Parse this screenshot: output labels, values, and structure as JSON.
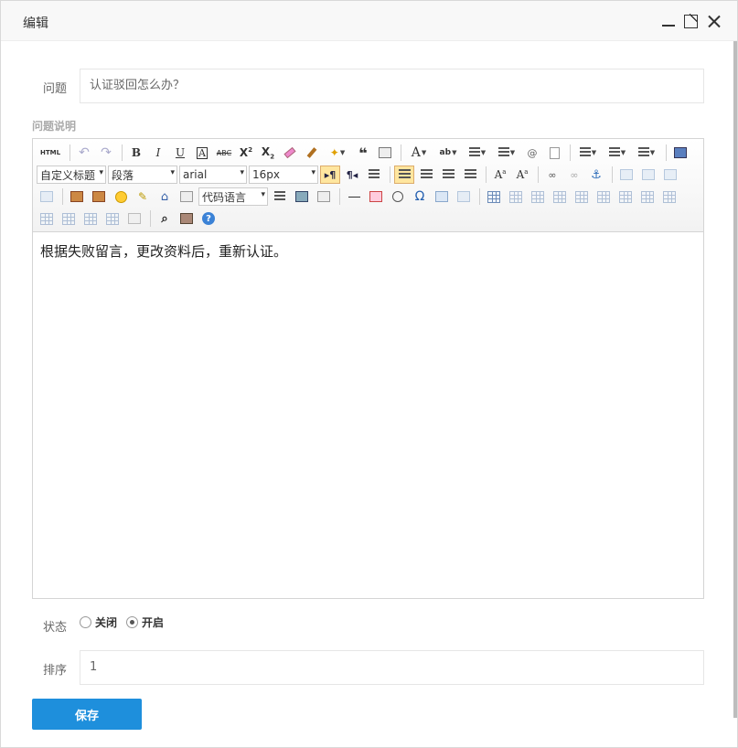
{
  "window": {
    "title": "编辑"
  },
  "form": {
    "question_label": "问题",
    "question_value": "认证驳回怎么办？",
    "description_label": "问题说明",
    "status_label": "状态",
    "status_options": [
      "关闭",
      "开启"
    ],
    "status_selected": "开启",
    "sort_label": "排序",
    "sort_value": "1",
    "save_label": "保存"
  },
  "editor": {
    "toolbar": {
      "html_label": "HTML",
      "custom_title_select": "自定义标题",
      "paragraph_select": "段落",
      "font_select": "arial",
      "size_select": "16px",
      "code_lang_select": "代码语言",
      "omega_symbol": "Ω"
    },
    "content": "根据失败留言，更改资料后，重新认证。"
  },
  "colors": {
    "accent": "#1e8fdc",
    "active_button": "#ffe69f"
  }
}
